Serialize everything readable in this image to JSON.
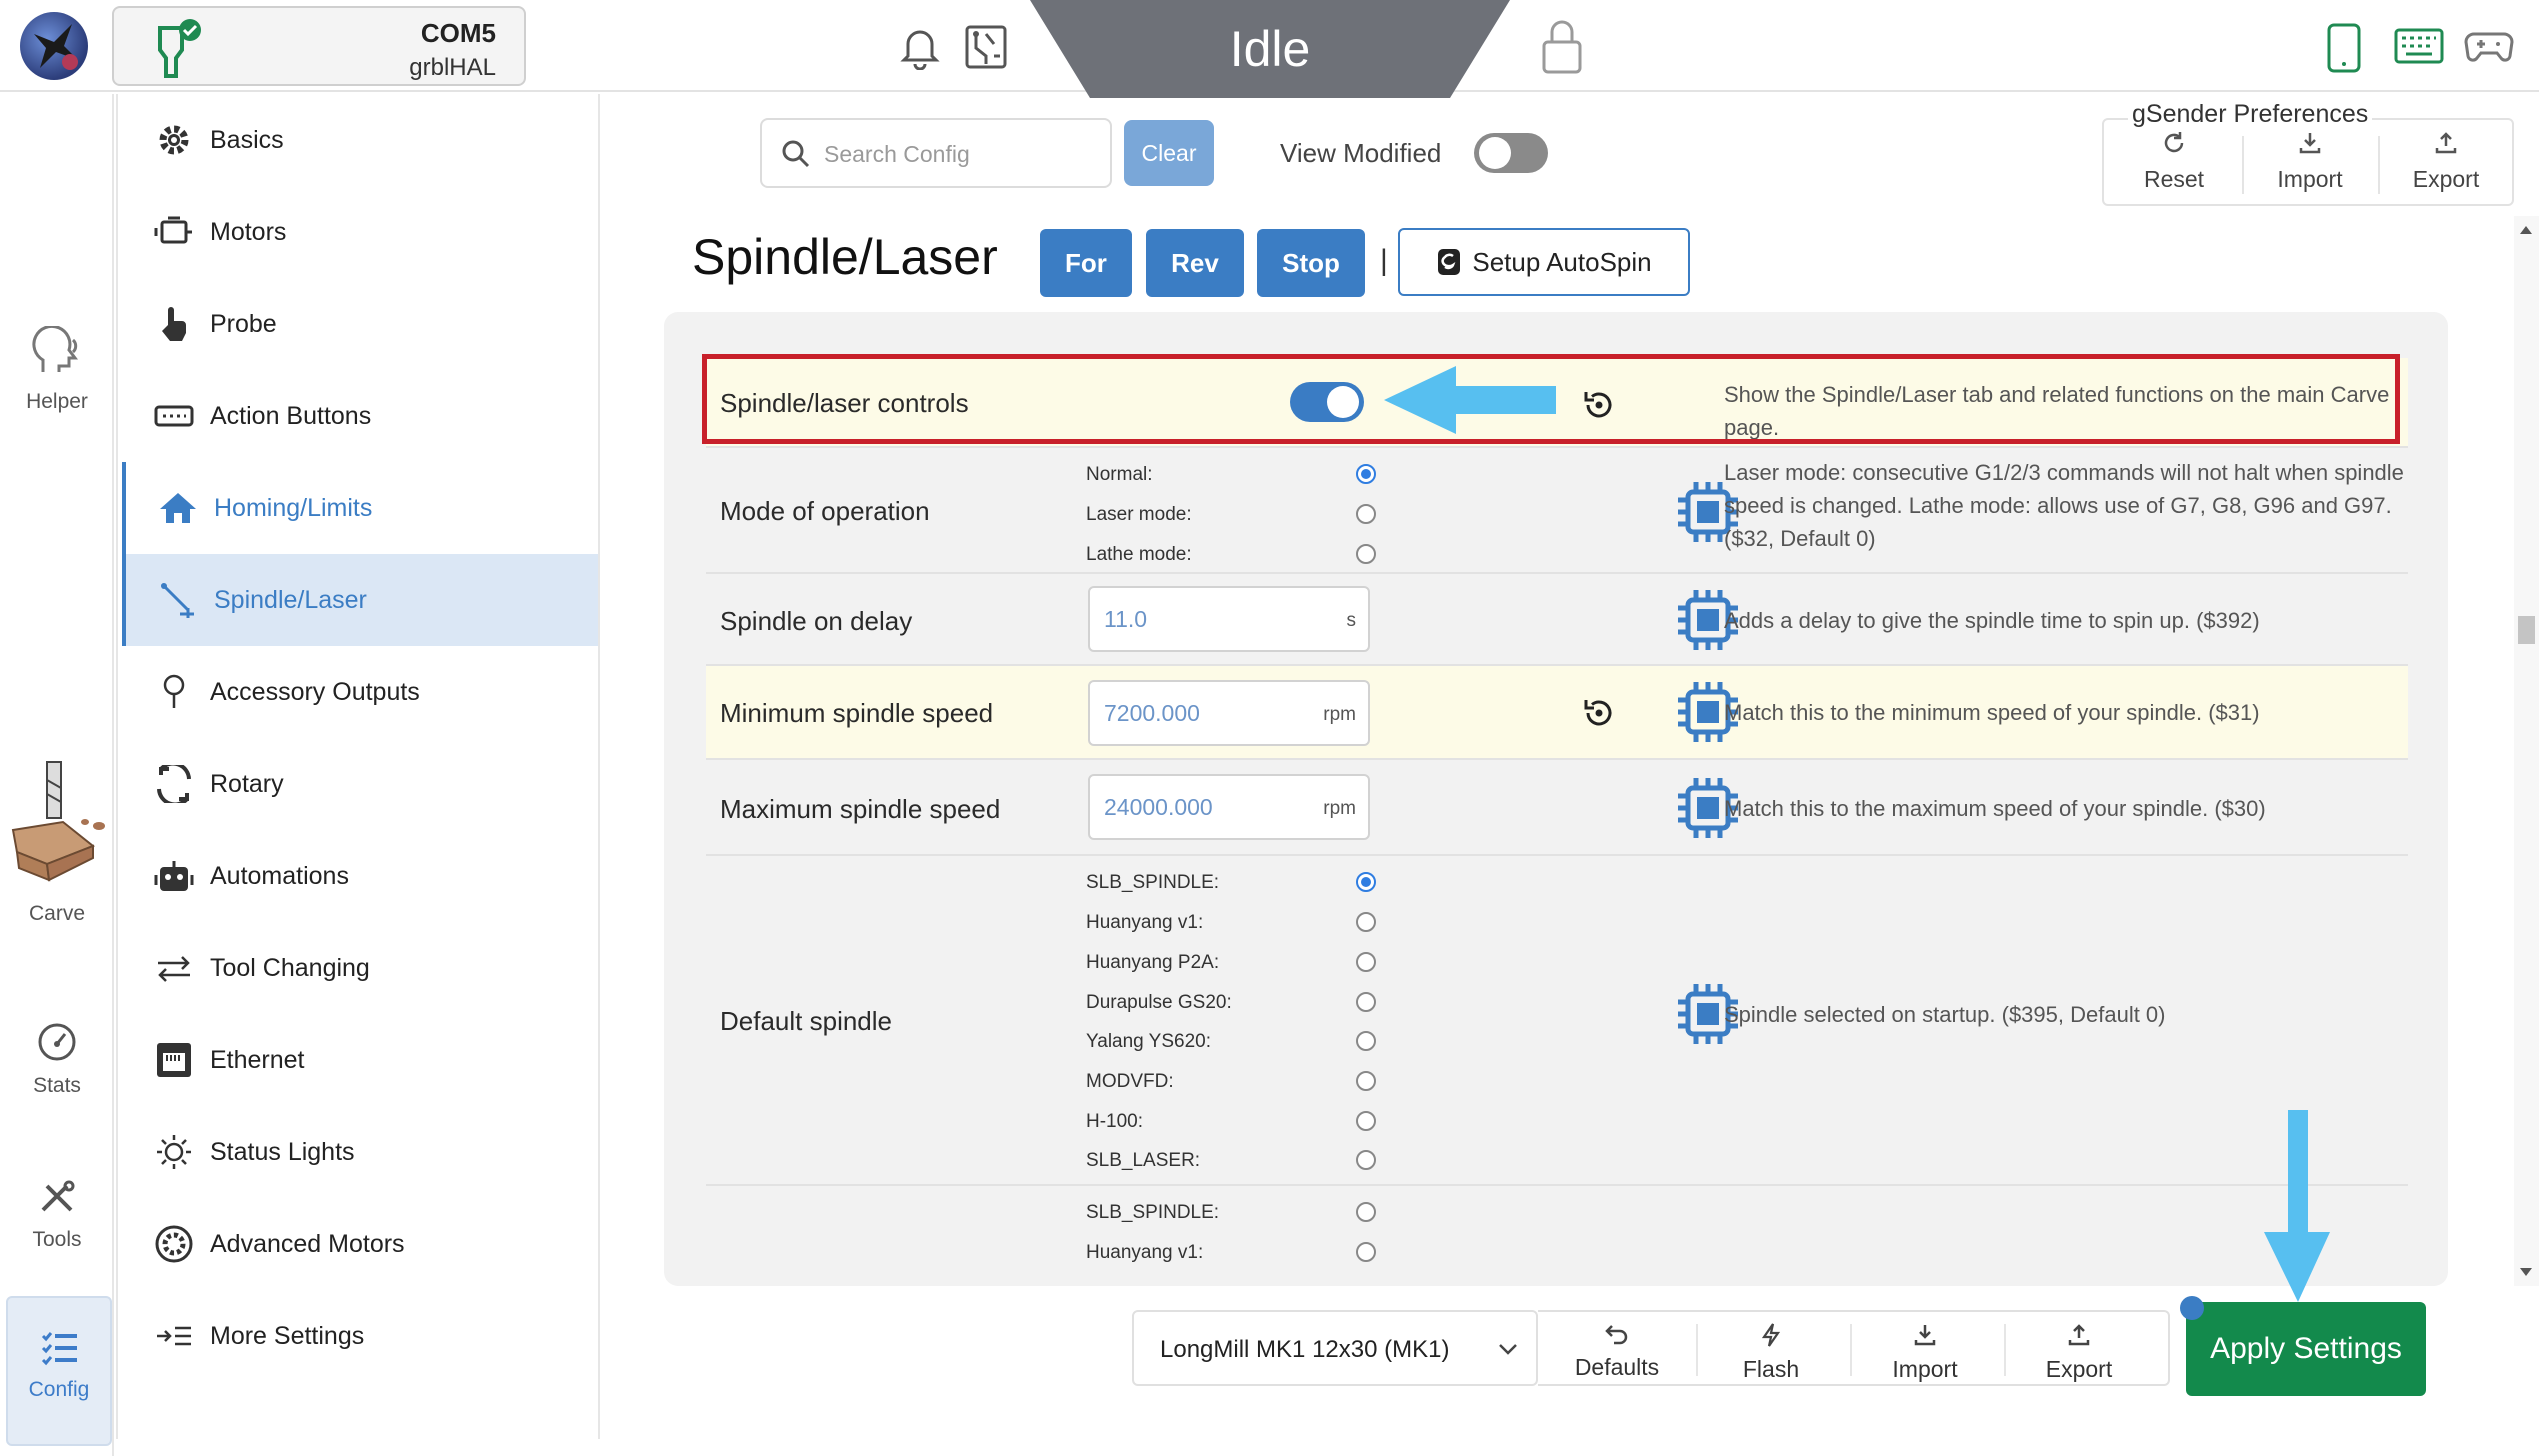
{
  "connection": {
    "port": "COM5",
    "firmware": "grblHAL"
  },
  "status": {
    "state": "Idle"
  },
  "rail": {
    "helper": "Helper",
    "carve": "Carve",
    "stats": "Stats",
    "tools": "Tools",
    "config": "Config"
  },
  "nav": {
    "items": [
      {
        "label": "Basics",
        "icon": "gear-icon"
      },
      {
        "label": "Motors",
        "icon": "motor-icon"
      },
      {
        "label": "Probe",
        "icon": "hand-pointer-icon"
      },
      {
        "label": "Action Buttons",
        "icon": "keyboard-icon"
      },
      {
        "label": "Homing/Limits",
        "icon": "home-icon"
      },
      {
        "label": "Spindle/Laser",
        "icon": "spindle-icon"
      },
      {
        "label": "Accessory Outputs",
        "icon": "bulb-icon"
      },
      {
        "label": "Rotary",
        "icon": "rotate-icon"
      },
      {
        "label": "Automations",
        "icon": "robot-icon"
      },
      {
        "label": "Tool Changing",
        "icon": "swap-arrows-icon"
      },
      {
        "label": "Ethernet",
        "icon": "ethernet-icon"
      },
      {
        "label": "Status Lights",
        "icon": "sun-icon"
      },
      {
        "label": "Advanced Motors",
        "icon": "circle-gear-icon"
      },
      {
        "label": "More Settings",
        "icon": "list-arrow-icon"
      }
    ]
  },
  "toolbar": {
    "search_placeholder": "Search Config",
    "clear": "Clear",
    "view_modified": "View Modified"
  },
  "prefs": {
    "title": "gSender Preferences",
    "reset": "Reset",
    "import": "Import",
    "export": "Export"
  },
  "header": {
    "title": "Spindle/Laser",
    "for": "For",
    "rev": "Rev",
    "stop": "Stop",
    "separator": "|",
    "autospin": "Setup AutoSpin"
  },
  "settings": {
    "spindle_controls": {
      "label": "Spindle/laser controls",
      "enabled": true,
      "desc": "Show the Spindle/Laser tab and related functions on the main Carve page."
    },
    "mode": {
      "label": "Mode of operation",
      "options": [
        "Normal:",
        "Laser mode:",
        "Lathe mode:"
      ],
      "selected": "Normal:",
      "desc": "Laser mode: consecutive G1/2/3 commands will not halt when spindle speed is changed. Lathe mode: allows use of G7, G8, G96 and G97. ($32, Default 0)"
    },
    "delay": {
      "label": "Spindle on delay",
      "value": "11.0",
      "unit": "s",
      "desc": "Adds a delay to give the spindle time to spin up. ($392)"
    },
    "min_speed": {
      "label": "Minimum spindle speed",
      "value": "7200.000",
      "unit": "rpm",
      "desc": "Match this to the minimum speed of your spindle. ($31)"
    },
    "max_speed": {
      "label": "Maximum spindle speed",
      "value": "24000.000",
      "unit": "rpm",
      "desc": "Match this to the maximum speed of your spindle. ($30)"
    },
    "default_spindle": {
      "label": "Default spindle",
      "options": [
        "SLB_SPINDLE:",
        "Huanyang v1:",
        "Huanyang P2A:",
        "Durapulse GS20:",
        "Yalang YS620:",
        "MODVFD:",
        "H-100:",
        "SLB_LASER:"
      ],
      "selected": "SLB_SPINDLE:",
      "desc": "Spindle selected on startup. ($395, Default 0)"
    },
    "next_row": {
      "options": [
        "SLB_SPINDLE:",
        "Huanyang v1:"
      ]
    }
  },
  "footer": {
    "machine": "LongMill MK1 12x30 (MK1)",
    "defaults": "Defaults",
    "flash": "Flash",
    "import": "Import",
    "export": "Export",
    "apply": "Apply Settings"
  },
  "colors": {
    "accent": "#3b7dc4",
    "apply": "#138a4c",
    "highlight_row": "#fdfbe7",
    "annotation_box": "#c8202a",
    "annotation_arrow": "#57bff0"
  }
}
